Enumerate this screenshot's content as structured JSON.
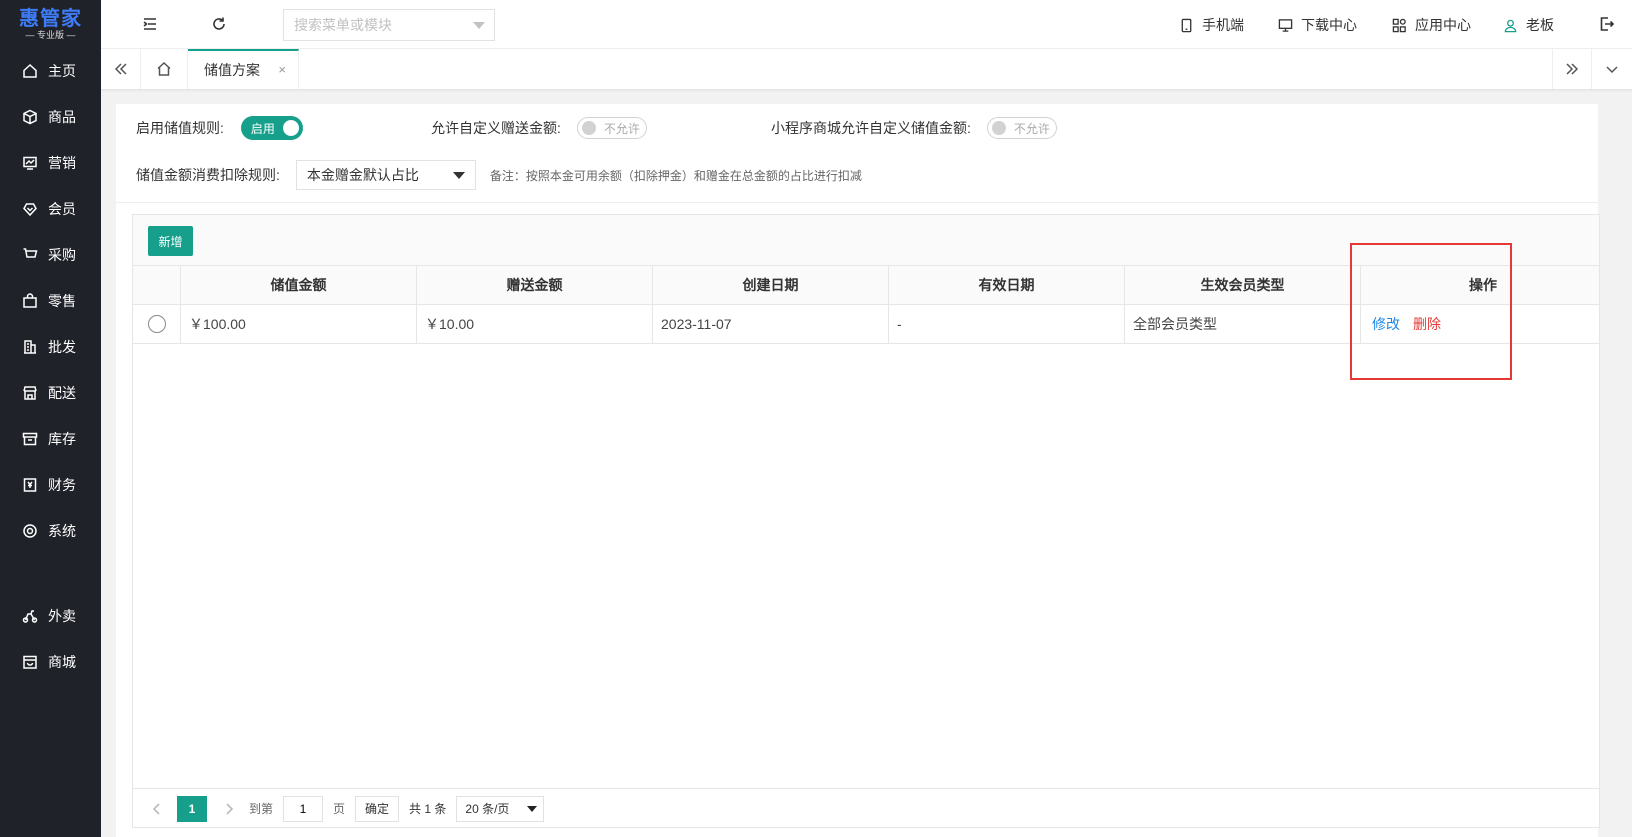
{
  "logo": {
    "main": "惠管家",
    "sub": "— 专业版 —"
  },
  "sidebar": {
    "items": [
      {
        "label": "主页",
        "icon": "home-icon"
      },
      {
        "label": "商品",
        "icon": "box-icon"
      },
      {
        "label": "营销",
        "icon": "chart-icon"
      },
      {
        "label": "会员",
        "icon": "heart-icon"
      },
      {
        "label": "采购",
        "icon": "cart-icon"
      },
      {
        "label": "零售",
        "icon": "bag-icon"
      },
      {
        "label": "批发",
        "icon": "building-icon"
      },
      {
        "label": "配送",
        "icon": "store-icon"
      },
      {
        "label": "库存",
        "icon": "archive-icon"
      },
      {
        "label": "财务",
        "icon": "yen-icon"
      },
      {
        "label": "系统",
        "icon": "settings-icon"
      },
      {
        "label": "外卖",
        "icon": "scooter-icon"
      },
      {
        "label": "商城",
        "icon": "shop-icon"
      }
    ]
  },
  "header": {
    "search_placeholder": "搜索菜单或模块",
    "mobile": "手机端",
    "download": "下载中心",
    "apps": "应用中心",
    "user": "老板"
  },
  "tabs": {
    "active": "储值方案",
    "close": "×"
  },
  "form": {
    "enable_label": "启用储值规则:",
    "enable_value": "启用",
    "custom_gift_label": "允许自定义赠送金额:",
    "custom_gift_value": "不允许",
    "mini_custom_label": "小程序商城允许自定义储值金额:",
    "mini_custom_value": "不允许",
    "deduct_label": "储值金额消费扣除规则:",
    "deduct_value": "本金赠金默认占比",
    "note": "备注：按照本金可用余额（扣除押金）和赠金在总金额的占比进行扣减"
  },
  "table": {
    "add_label": "新增",
    "headers": [
      "储值金额",
      "赠送金额",
      "创建日期",
      "有效日期",
      "生效会员类型",
      "操作"
    ],
    "rows": [
      {
        "amount": "￥100.00",
        "gift": "￥10.00",
        "created": "2023-11-07",
        "valid": "-",
        "member_type": "全部会员类型",
        "edit": "修改",
        "delete": "删除"
      }
    ]
  },
  "pager": {
    "current": "1",
    "goto_label": "到第",
    "goto_value": "1",
    "page_unit": "页",
    "confirm": "确定",
    "total": "共 1 条",
    "page_size": "20 条/页"
  },
  "colors": {
    "accent": "#16a08c",
    "sidebar": "#20222a",
    "link": "#1e88e5",
    "danger": "#e53935"
  }
}
